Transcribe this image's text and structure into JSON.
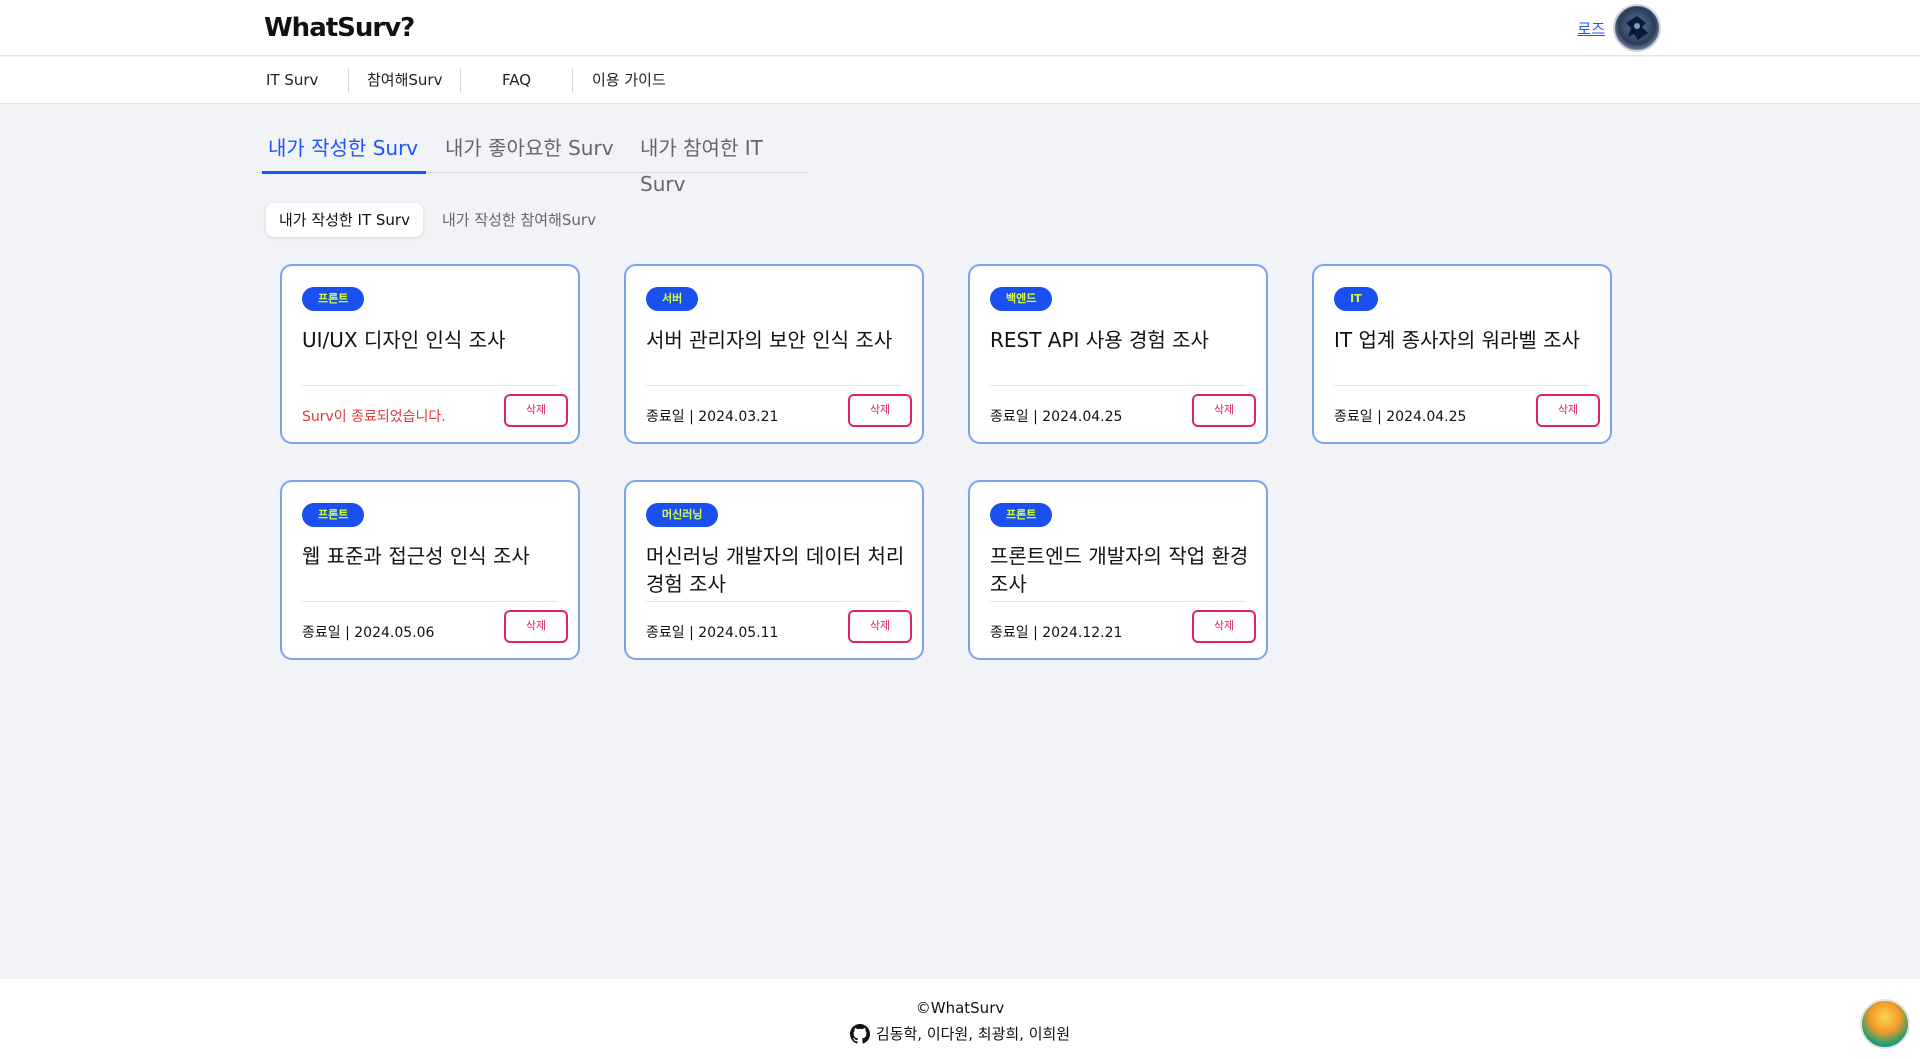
{
  "header": {
    "logo": "WhatSurv?",
    "user_name": "로즈"
  },
  "nav": {
    "items": [
      "IT Surv",
      "참여해Surv",
      "FAQ",
      "이용 가이드"
    ]
  },
  "tabs": [
    "내가 작성한 Surv",
    "내가 좋아요한 Surv",
    "내가 참여한 IT Surv"
  ],
  "subtabs": [
    "내가 작성한 IT Surv",
    "내가 작성한 참여해Surv"
  ],
  "delete_label": "삭제",
  "cards": [
    {
      "badge": "프론트",
      "title": "UI/UX 디자인 인식 조사",
      "date": "Surv이 종료되었습니다."
    },
    {
      "badge": "서버",
      "title": "서버 관리자의 보안 인식 조사",
      "date": "종료일 | 2024.03.21"
    },
    {
      "badge": "백엔드",
      "title": "REST API 사용 경험 조사",
      "date": "종료일 | 2024.04.25"
    },
    {
      "badge": "IT",
      "title": "IT 업계 종사자의 워라벨 조사",
      "date": "종료일 | 2024.04.25"
    },
    {
      "badge": "프론트",
      "title": "웹 표준과 접근성 인식 조사",
      "date": "종료일 | 2024.05.06"
    },
    {
      "badge": "머신러닝",
      "title": "머신러닝 개발자의 데이터 처리 경험 조사",
      "date": "종료일 | 2024.05.11"
    },
    {
      "badge": "프론트",
      "title": "프론트엔드 개발자의 작업 환경 조사",
      "date": "종료일 | 2024.12.21"
    }
  ],
  "footer": {
    "copyright": "©WhatSurv",
    "members": "김동학, 이다원, 최광희, 이희원"
  }
}
